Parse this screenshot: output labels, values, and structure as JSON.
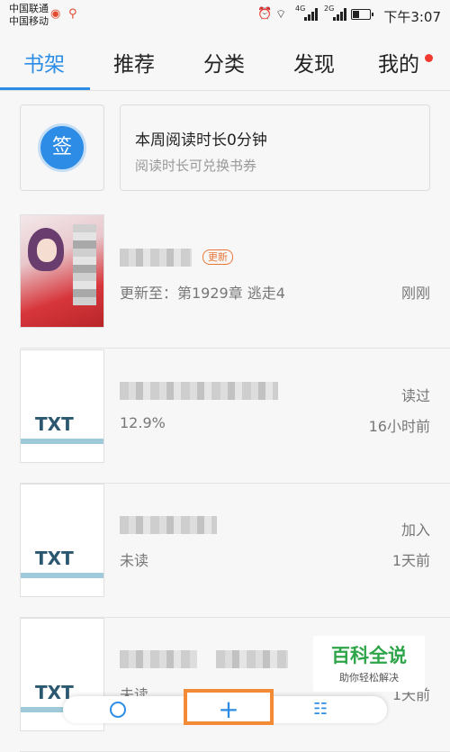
{
  "status_bar": {
    "carrier1": "中国联通",
    "carrier2": "中国移动",
    "net1": "4G",
    "net2": "2G",
    "time": "下午3:07"
  },
  "tabs": [
    {
      "label": "书架",
      "active": true
    },
    {
      "label": "推荐",
      "active": false
    },
    {
      "label": "分类",
      "active": false
    },
    {
      "label": "发现",
      "active": false
    },
    {
      "label": "我的",
      "active": false
    }
  ],
  "signin": {
    "button_label": "签",
    "reading_title": "本周阅读时长0分钟",
    "reading_sub": "阅读时长可兑换书券"
  },
  "books": [
    {
      "badge": "更新",
      "progress": "更新至：第1929章 逃走4",
      "status": "",
      "time": "刚刚"
    },
    {
      "cover_label": "TXT",
      "progress": "12.9%",
      "status": "读过",
      "time": "16小时前"
    },
    {
      "cover_label": "TXT",
      "progress": "未读",
      "status": "加入",
      "time": "1天前"
    },
    {
      "cover_label": "TXT",
      "progress": "未读",
      "status": "",
      "time": "1天前"
    }
  ],
  "watermark": {
    "title": "百科全说",
    "sub": "助你轻松解决"
  },
  "bottom_bar": {
    "add_label": "+",
    "list_icon": "☷"
  },
  "colors": {
    "accent": "#2d8ce5",
    "badge": "#e8773a",
    "notify": "#f23b30"
  }
}
